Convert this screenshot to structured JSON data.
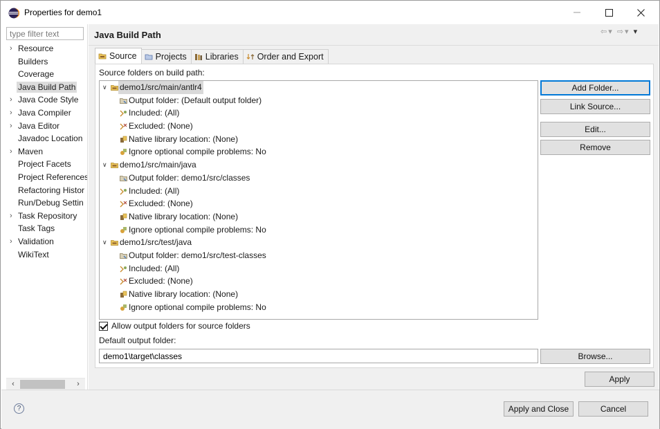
{
  "window": {
    "title": "Properties for demo1"
  },
  "filter": {
    "placeholder": "type filter text"
  },
  "nav": [
    {
      "label": "Resource",
      "expandable": true
    },
    {
      "label": "Builders",
      "expandable": false
    },
    {
      "label": "Coverage",
      "expandable": false
    },
    {
      "label": "Java Build Path",
      "expandable": false,
      "selected": true
    },
    {
      "label": "Java Code Style",
      "expandable": true
    },
    {
      "label": "Java Compiler",
      "expandable": true
    },
    {
      "label": "Java Editor",
      "expandable": true
    },
    {
      "label": "Javadoc Location",
      "expandable": false
    },
    {
      "label": "Maven",
      "expandable": true
    },
    {
      "label": "Project Facets",
      "expandable": false
    },
    {
      "label": "Project References",
      "expandable": false
    },
    {
      "label": "Refactoring Histor",
      "expandable": false
    },
    {
      "label": "Run/Debug Settin",
      "expandable": false
    },
    {
      "label": "Task Repository",
      "expandable": true
    },
    {
      "label": "Task Tags",
      "expandable": false
    },
    {
      "label": "Validation",
      "expandable": true
    },
    {
      "label": "WikiText",
      "expandable": false
    }
  ],
  "page": {
    "title": "Java Build Path"
  },
  "tabs": [
    {
      "label": "Source",
      "active": true
    },
    {
      "label": "Projects",
      "active": false
    },
    {
      "label": "Libraries",
      "active": false
    },
    {
      "label": "Order and Export",
      "active": false
    }
  ],
  "source": {
    "list_label": "Source folders on build path:",
    "folders": [
      {
        "path": "demo1/src/main/antlr4",
        "selected": true,
        "children": [
          {
            "icon": "output-folder-icon",
            "text": "Output folder: (Default output folder)"
          },
          {
            "icon": "included-icon",
            "text": "Included: (All)"
          },
          {
            "icon": "excluded-icon",
            "text": "Excluded: (None)"
          },
          {
            "icon": "native-library-icon",
            "text": "Native library location: (None)"
          },
          {
            "icon": "ignore-problems-icon",
            "text": "Ignore optional compile problems: No"
          }
        ]
      },
      {
        "path": "demo1/src/main/java",
        "selected": false,
        "children": [
          {
            "icon": "output-folder-icon",
            "text": "Output folder: demo1/src/classes"
          },
          {
            "icon": "included-icon",
            "text": "Included: (All)"
          },
          {
            "icon": "excluded-icon",
            "text": "Excluded: (None)"
          },
          {
            "icon": "native-library-icon",
            "text": "Native library location: (None)"
          },
          {
            "icon": "ignore-problems-icon",
            "text": "Ignore optional compile problems: No"
          }
        ]
      },
      {
        "path": "demo1/src/test/java",
        "selected": false,
        "children": [
          {
            "icon": "output-folder-icon",
            "text": "Output folder: demo1/src/test-classes"
          },
          {
            "icon": "included-icon",
            "text": "Included: (All)"
          },
          {
            "icon": "excluded-icon",
            "text": "Excluded: (None)"
          },
          {
            "icon": "native-library-icon",
            "text": "Native library location: (None)"
          },
          {
            "icon": "ignore-problems-icon",
            "text": "Ignore optional compile problems: No"
          }
        ]
      }
    ],
    "buttons": {
      "add_folder": "Add Folder...",
      "link_source": "Link Source...",
      "edit": "Edit...",
      "remove": "Remove"
    },
    "allow_output_label": "Allow output folders for source folders",
    "allow_output_checked": true,
    "default_output_label": "Default output folder:",
    "default_output_value": "demo1\\target\\classes",
    "browse": "Browse..."
  },
  "apply": "Apply",
  "footer": {
    "help": "?",
    "apply_close": "Apply and Close",
    "cancel": "Cancel"
  }
}
